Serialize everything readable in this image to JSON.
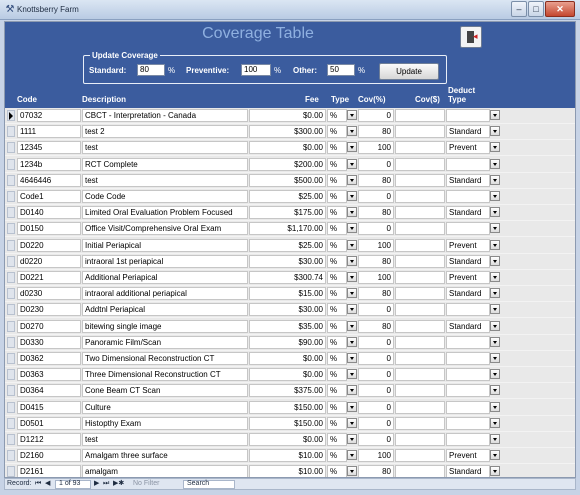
{
  "window": {
    "title": "Knottsberry Farm",
    "min_glyph": "–",
    "max_glyph": "□",
    "close_glyph": "✕",
    "app_icon": "tooth-icon"
  },
  "form": {
    "title": "Coverage Table",
    "exit_icon": "exit-door-icon"
  },
  "update_coverage": {
    "legend": "Update Coverage",
    "standard_label": "Standard:",
    "standard_value": "80",
    "preventive_label": "Preventive:",
    "preventive_value": "100",
    "other_label": "Other:",
    "other_value": "50",
    "percent_sign": "%",
    "update_button": "Update"
  },
  "columns": {
    "code": "Code",
    "description": "Description",
    "fee": "Fee",
    "type": "Type",
    "cov_pct": "Cov(%)",
    "cov_dollar": "Cov($)",
    "deduct_type_1": "Deduct",
    "deduct_type_2": "Type"
  },
  "rows": [
    {
      "code": "07032",
      "description": "CBCT - Interpretation - Canada",
      "fee": "$0.00",
      "type": "%",
      "cov_pct": "0",
      "cov_dollar": "",
      "deduct": ""
    },
    {
      "code": "1111",
      "description": "test 2",
      "fee": "$300.00",
      "type": "%",
      "cov_pct": "80",
      "cov_dollar": "",
      "deduct": "Standard"
    },
    {
      "code": "12345",
      "description": "test",
      "fee": "$0.00",
      "type": "%",
      "cov_pct": "100",
      "cov_dollar": "",
      "deduct": "Prevent"
    },
    {
      "code": "1234b",
      "description": "RCT Complete",
      "fee": "$200.00",
      "type": "%",
      "cov_pct": "0",
      "cov_dollar": "",
      "deduct": ""
    },
    {
      "code": "4646446",
      "description": "test",
      "fee": "$500.00",
      "type": "%",
      "cov_pct": "80",
      "cov_dollar": "",
      "deduct": "Standard"
    },
    {
      "code": "Code1",
      "description": "Code Code",
      "fee": "$25.00",
      "type": "%",
      "cov_pct": "0",
      "cov_dollar": "",
      "deduct": ""
    },
    {
      "code": "D0140",
      "description": "Limited Oral Evaluation Problem Focused",
      "fee": "$175.00",
      "type": "%",
      "cov_pct": "80",
      "cov_dollar": "",
      "deduct": "Standard"
    },
    {
      "code": "D0150",
      "description": "Office Visit/Comprehensive Oral Exam",
      "fee": "$1,170.00",
      "type": "%",
      "cov_pct": "0",
      "cov_dollar": "",
      "deduct": ""
    },
    {
      "code": "D0220",
      "description": "Initial Periapical",
      "fee": "$25.00",
      "type": "%",
      "cov_pct": "100",
      "cov_dollar": "",
      "deduct": "Prevent"
    },
    {
      "code": "d0220",
      "description": "intraoral 1st periapical",
      "fee": "$30.00",
      "type": "%",
      "cov_pct": "80",
      "cov_dollar": "",
      "deduct": "Standard"
    },
    {
      "code": "D0221",
      "description": "Additional Periapical",
      "fee": "$300.74",
      "type": "%",
      "cov_pct": "100",
      "cov_dollar": "",
      "deduct": "Prevent"
    },
    {
      "code": "d0230",
      "description": "intraoral additional periapical",
      "fee": "$15.00",
      "type": "%",
      "cov_pct": "80",
      "cov_dollar": "",
      "deduct": "Standard"
    },
    {
      "code": "D0230",
      "description": "Addtnl Periapical",
      "fee": "$30.00",
      "type": "%",
      "cov_pct": "0",
      "cov_dollar": "",
      "deduct": ""
    },
    {
      "code": "D0270",
      "description": "bitewing single image",
      "fee": "$35.00",
      "type": "%",
      "cov_pct": "80",
      "cov_dollar": "",
      "deduct": "Standard"
    },
    {
      "code": "D0330",
      "description": "Panoramic Film/Scan",
      "fee": "$90.00",
      "type": "%",
      "cov_pct": "0",
      "cov_dollar": "",
      "deduct": ""
    },
    {
      "code": "D0362",
      "description": "Two Dimensional Reconstruction CT",
      "fee": "$0.00",
      "type": "%",
      "cov_pct": "0",
      "cov_dollar": "",
      "deduct": ""
    },
    {
      "code": "D0363",
      "description": "Three Dimensional Reconstruction CT",
      "fee": "$0.00",
      "type": "%",
      "cov_pct": "0",
      "cov_dollar": "",
      "deduct": ""
    },
    {
      "code": "D0364",
      "description": "Cone Beam CT Scan",
      "fee": "$375.00",
      "type": "%",
      "cov_pct": "0",
      "cov_dollar": "",
      "deduct": ""
    },
    {
      "code": "D0415",
      "description": "Culture",
      "fee": "$150.00",
      "type": "%",
      "cov_pct": "0",
      "cov_dollar": "",
      "deduct": ""
    },
    {
      "code": "D0501",
      "description": "Histopthy Exam",
      "fee": "$150.00",
      "type": "%",
      "cov_pct": "0",
      "cov_dollar": "",
      "deduct": ""
    },
    {
      "code": "D1212",
      "description": "test",
      "fee": "$0.00",
      "type": "%",
      "cov_pct": "0",
      "cov_dollar": "",
      "deduct": ""
    },
    {
      "code": "D2160",
      "description": "Amalgam three surface",
      "fee": "$10.00",
      "type": "%",
      "cov_pct": "100",
      "cov_dollar": "",
      "deduct": "Prevent"
    },
    {
      "code": "D2161",
      "description": "amalgam",
      "fee": "$10.00",
      "type": "%",
      "cov_pct": "80",
      "cov_dollar": "",
      "deduct": "Standard"
    }
  ],
  "statusbar": {
    "record_label": "Record:",
    "first": "⏮",
    "prev": "◀",
    "position": "1 of 93",
    "next": "▶",
    "last": "⏭",
    "new": "▶✱",
    "filter": "No Filter",
    "search": "Search"
  }
}
